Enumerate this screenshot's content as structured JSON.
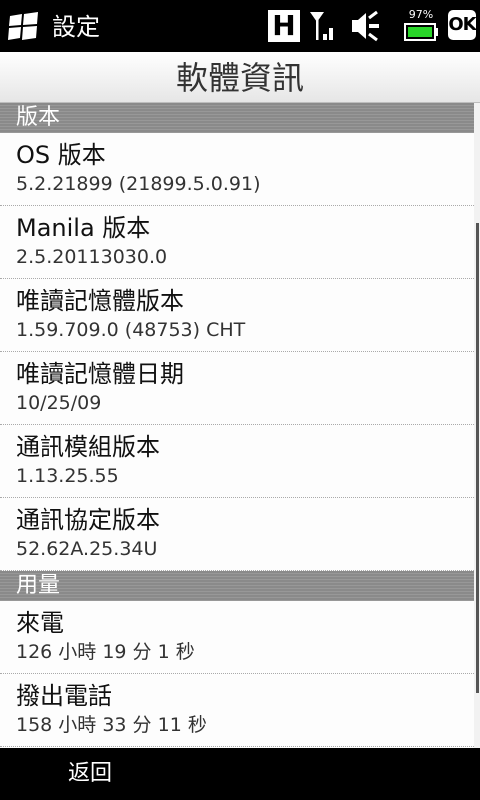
{
  "statusbar": {
    "title": "設定",
    "battery_percent": "97%",
    "network_label": "H",
    "ok_label": "OK"
  },
  "header": {
    "title": "軟體資訊"
  },
  "sections": [
    {
      "title": "版本",
      "items": [
        {
          "label": "OS 版本",
          "value": "5.2.21899 (21899.5.0.91)"
        },
        {
          "label": "Manila 版本",
          "value": "2.5.20113030.0"
        },
        {
          "label": "唯讀記憶體版本",
          "value": "1.59.709.0 (48753) CHT"
        },
        {
          "label": "唯讀記憶體日期",
          "value": "10/25/09"
        },
        {
          "label": "通訊模組版本",
          "value": "1.13.25.55"
        },
        {
          "label": "通訊協定版本",
          "value": "52.62A.25.34U"
        }
      ]
    },
    {
      "title": "用量",
      "items": [
        {
          "label": "來電",
          "value": "126 小時 19 分 1 秒"
        },
        {
          "label": "撥出電話",
          "value": "158 小時 33 分 11 秒"
        }
      ]
    }
  ],
  "softbar": {
    "left_label": "返回"
  },
  "colors": {
    "battery": "#29d629",
    "section_bg": "#8a8a8a"
  }
}
